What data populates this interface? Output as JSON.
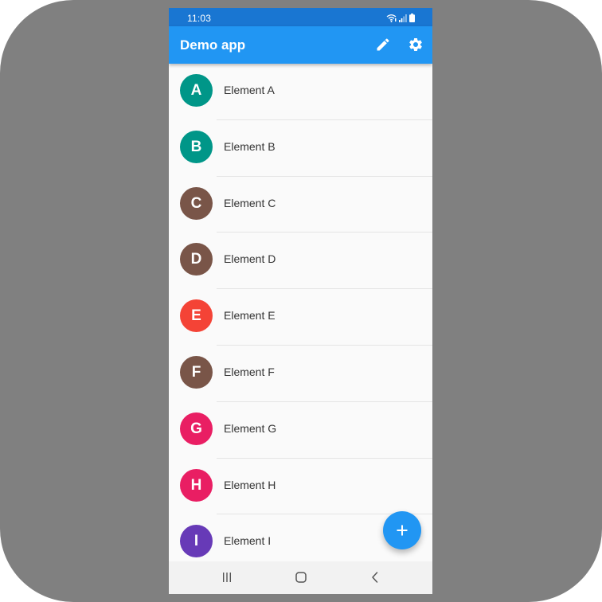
{
  "status_bar": {
    "time": "11:03",
    "icons": [
      "wifi-icon",
      "signal-icon",
      "battery-icon"
    ],
    "color": "#1976d2"
  },
  "app_bar": {
    "title": "Demo app",
    "color": "#2196f3",
    "actions": [
      "edit-icon",
      "settings-icon"
    ]
  },
  "list": {
    "items": [
      {
        "initial": "A",
        "label": "Element A",
        "color": "#009688"
      },
      {
        "initial": "B",
        "label": "Element B",
        "color": "#009688"
      },
      {
        "initial": "C",
        "label": "Element C",
        "color": "#795548"
      },
      {
        "initial": "D",
        "label": "Element D",
        "color": "#795548"
      },
      {
        "initial": "E",
        "label": "Element E",
        "color": "#f44336"
      },
      {
        "initial": "F",
        "label": "Element F",
        "color": "#795548"
      },
      {
        "initial": "G",
        "label": "Element G",
        "color": "#e91e63"
      },
      {
        "initial": "H",
        "label": "Element H",
        "color": "#e91e63"
      },
      {
        "initial": "I",
        "label": "Element I",
        "color": "#673ab7"
      }
    ]
  },
  "fab": {
    "icon": "plus-icon",
    "color": "#2196f3"
  },
  "navigation": {
    "buttons": [
      "recent-apps-icon",
      "home-icon",
      "back-icon"
    ]
  }
}
